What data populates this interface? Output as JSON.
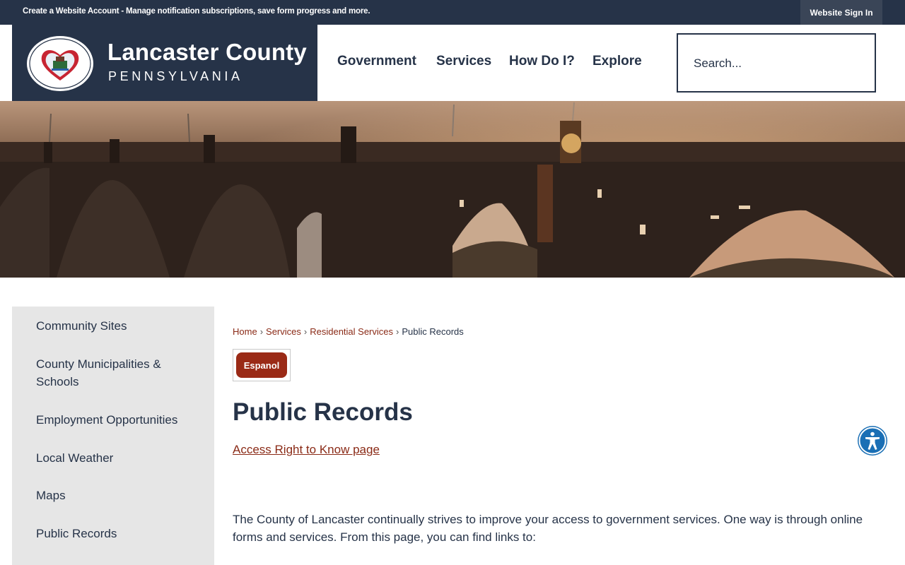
{
  "topbar": {
    "account_text": "Create a Website Account - Manage notification subscriptions, save form progress and more.",
    "signin_label": "Website Sign In"
  },
  "header": {
    "title": "Lancaster County",
    "subtitle": "PENNSYLVANIA",
    "seal_icon": "county-seal-icon"
  },
  "nav": {
    "items": [
      {
        "label": "Government"
      },
      {
        "label": "Services"
      },
      {
        "label": "How Do I?"
      },
      {
        "label": "Explore"
      }
    ]
  },
  "search": {
    "placeholder": "Search..."
  },
  "sidebar": {
    "items": [
      {
        "label": "Community Sites"
      },
      {
        "label": "County Municipalities & Schools"
      },
      {
        "label": "Employment Opportunities"
      },
      {
        "label": "Local Weather"
      },
      {
        "label": "Maps"
      },
      {
        "label": "Public Records"
      }
    ]
  },
  "breadcrumb": {
    "items": [
      {
        "label": "Home"
      },
      {
        "label": "Services"
      },
      {
        "label": "Residential Services"
      }
    ],
    "current": "Public Records",
    "separator": "›"
  },
  "main": {
    "espanol_label": "Espanol",
    "title": "Public Records",
    "rtk_link": "Access Right to Know page",
    "intro": "The County of Lancaster continually strives to improve your access to government services. One way is through online forms and services. From this page, you can find links to:"
  },
  "accessibility": {
    "icon": "accessibility-icon",
    "color": "#1a6fb5"
  },
  "colors": {
    "navy": "#263348",
    "link_red": "#8a2a16",
    "button_red": "#9a2a16",
    "sidebar_gray": "#e6e6e6"
  }
}
